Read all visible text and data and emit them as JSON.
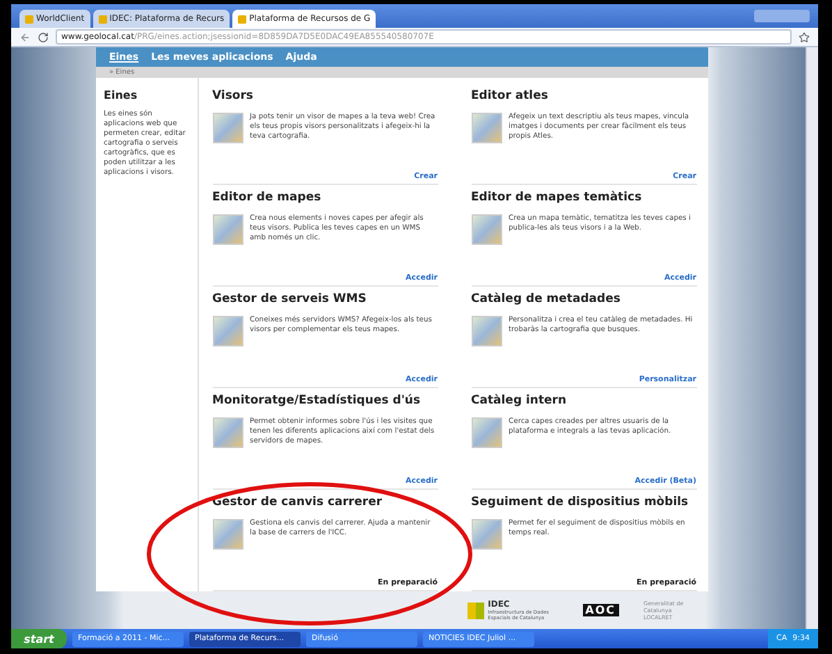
{
  "browser": {
    "tabs": [
      {
        "label": "WorldClient",
        "selected": false
      },
      {
        "label": "IDEC: Plataforma de Recurs",
        "selected": false
      },
      {
        "label": "Plataforma de Recursos de G",
        "selected": true
      }
    ],
    "url_host": "www.geolocal.cat",
    "url_path": "/PRG/eines.action;jsessionid=8D859DA7D5E0DAC49EA855540580707E"
  },
  "nav": [
    {
      "label": "Eines",
      "selected": true
    },
    {
      "label": "Les meves aplicacions",
      "selected": false
    },
    {
      "label": "Ajuda",
      "selected": false
    }
  ],
  "breadcrumb": "» Eines",
  "sidebar": {
    "title": "Eines",
    "text": "Les eines són aplicacions web que permeten crear, editar cartografia o serveis cartogràfics, que es poden utilitzar a les aplicacions i visors."
  },
  "cards": [
    {
      "title": "Visors",
      "text": "Ja pots tenir un visor de mapes a la teva web! Crea els teus propis visors personalitzats i afegeix-hi la teva cartografia.",
      "action": "Crear",
      "kind": "link"
    },
    {
      "title": "Editor atles",
      "text": "Afegeix un text descriptiu als teus mapes, vincula imatges i documents per crear fàcilment els teus propis Atles.",
      "action": "Crear",
      "kind": "link"
    },
    {
      "title": "Editor de mapes",
      "text": "Crea nous elements i noves capes per afegir als teus visors. Publica les teves capes en un WMS amb només un clic.",
      "action": "Accedir",
      "kind": "link"
    },
    {
      "title": "Editor de mapes temàtics",
      "text": "Crea un mapa temàtic, tematitza les teves capes i publica-les als teus visors i a la Web.",
      "action": "Accedir",
      "kind": "link"
    },
    {
      "title": "Gestor de serveis WMS",
      "text": "Coneixes més servidors WMS? Afegeix-los als teus visors per complementar els teus mapes.",
      "action": "Accedir",
      "kind": "link"
    },
    {
      "title": "Catàleg de metadades",
      "text": "Personalitza i crea el teu catàleg de metadades. Hi trobaràs la cartografia que busques.",
      "action": "Personalitzar",
      "kind": "link"
    },
    {
      "title": "Monitoratge/Estadístiques d'ús",
      "text": "Permet obtenir informes sobre l'ús i les visites que tenen les diferents aplicacions així com l'estat dels servidors de mapes.",
      "action": "Accedir",
      "kind": "link"
    },
    {
      "title": "Catàleg intern",
      "text": "Cerca capes creades per altres usuaris de la plataforma e integrals a las tevas aplicación.",
      "action": "Accedir (Beta)",
      "kind": "link"
    },
    {
      "title": "Gestor de canvis carrerer",
      "text": "Gestiona els canvis del carrerer. Ajuda a mantenir la base de carrers de l'ICC.",
      "action": "En preparació",
      "kind": "status"
    },
    {
      "title": "Seguiment de dispositius mòbils",
      "text": "Permet fer el seguiment de dispositius mòbils en temps real.",
      "action": "En preparació",
      "kind": "status"
    }
  ],
  "footer": {
    "idec": "IDEC",
    "idec_sub": "Infraestructura de Dades Espacials de Catalunya",
    "aoc": "AOC",
    "gencat": "Generalitat de Catalunya",
    "localret": "LOCALRET"
  },
  "taskbar": {
    "start": "start",
    "items": [
      {
        "label": "Formació a 2011 - Mic...",
        "selected": false
      },
      {
        "label": "Plataforma de Recurs...",
        "selected": true
      },
      {
        "label": "Difusió",
        "selected": false
      },
      {
        "label": "NOTICIES IDEC Juliol ...",
        "selected": false
      }
    ],
    "lang": "CA",
    "time": "9:34"
  }
}
